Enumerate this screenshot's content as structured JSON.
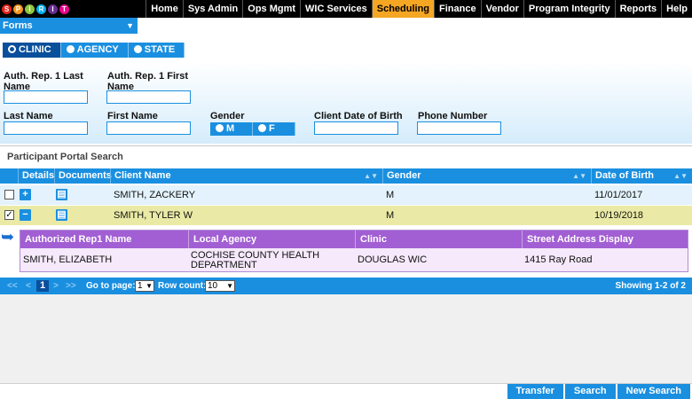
{
  "nav": {
    "logo_letters": [
      "S",
      "P",
      "I",
      "R",
      "I",
      "T"
    ],
    "logo_colors": [
      "#e2231a",
      "#f7941d",
      "#8dc63f",
      "#00aeef",
      "#662d91",
      "#ec008c"
    ],
    "items": [
      "Home",
      "Sys Admin",
      "Ops Mgmt",
      "WIC Services",
      "Scheduling",
      "Finance",
      "Vendor",
      "Program Integrity",
      "Reports",
      "Help"
    ],
    "active": "Scheduling"
  },
  "forms_menu": {
    "label": "Forms"
  },
  "scope": {
    "options": [
      "CLINIC",
      "AGENCY",
      "STATE"
    ],
    "selected": "CLINIC"
  },
  "search_form": {
    "auth_last_label": "Auth. Rep. 1 Last Name",
    "auth_first_label": "Auth. Rep. 1 First Name",
    "last_name_label": "Last Name",
    "first_name_label": "First Name",
    "gender_label": "Gender",
    "gender_options": [
      "M",
      "F"
    ],
    "dob_label": "Client Date of Birth",
    "phone_label": "Phone Number",
    "values": {
      "auth_last": "",
      "auth_first": "",
      "last_name": "",
      "first_name": "",
      "dob": "",
      "phone": ""
    }
  },
  "results": {
    "title": "Participant Portal Search",
    "columns": [
      "Details",
      "Documents",
      "Client Name",
      "Gender",
      "Date of Birth"
    ],
    "rows": [
      {
        "checked": false,
        "client_name": "SMITH, ZACKERY",
        "gender": "M",
        "dob": "11/01/2017",
        "details_icon": "+"
      },
      {
        "checked": true,
        "client_name": "SMITH, TYLER W",
        "gender": "M",
        "dob": "10/19/2018",
        "details_icon": "−"
      }
    ],
    "subgrid": {
      "columns": [
        "Authorized Rep1 Name",
        "Local Agency",
        "Clinic",
        "Street Address Display"
      ],
      "row": {
        "rep_name": "SMITH, ELIZABETH",
        "local_agency": "COCHISE COUNTY HEALTH DEPARTMENT",
        "clinic": "DOUGLAS WIC",
        "street": "1415 Ray Road"
      }
    },
    "pager": {
      "first": "<<",
      "prev": "<",
      "current_page": "1",
      "next": ">",
      "last": ">>",
      "goto_label": "Go to page:",
      "goto_value": "1",
      "rowcount_label": "Row count:",
      "rowcount_value": "10",
      "showing": "Showing 1-2 of 2"
    }
  },
  "buttons": {
    "transfer": "Transfer",
    "search": "Search",
    "new_search": "New Search"
  }
}
